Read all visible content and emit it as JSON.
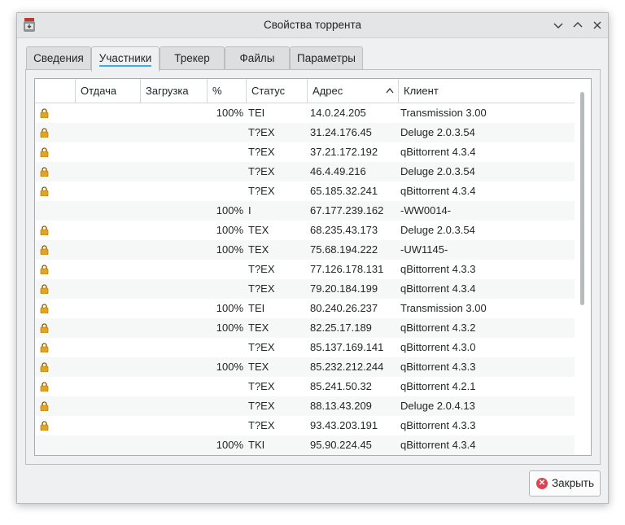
{
  "window": {
    "title": "Свойства торрента",
    "controls": {
      "minimize": "⌄",
      "maximize": "⌃",
      "close": "✕"
    }
  },
  "tabs": [
    {
      "label": "Сведения"
    },
    {
      "label": "Участники",
      "active": true
    },
    {
      "label": "Трекер"
    },
    {
      "label": "Файлы"
    },
    {
      "label": "Параметры"
    }
  ],
  "peers": {
    "columns": {
      "lock": "",
      "upload": "Отдача",
      "download": "Загрузка",
      "percent": "%",
      "status": "Статус",
      "address": "Адрес",
      "client": "Клиент"
    },
    "sort": {
      "column": "address",
      "direction": "ascending",
      "icon": "chevron-up-icon"
    },
    "rows": [
      {
        "lock": true,
        "percent": "100%",
        "status": "TEI",
        "address": "14.0.24.205",
        "client": "Transmission 3.00"
      },
      {
        "lock": true,
        "percent": "",
        "status": "T?EX",
        "address": "31.24.176.45",
        "client": "Deluge 2.0.3.54"
      },
      {
        "lock": true,
        "percent": "",
        "status": "T?EX",
        "address": "37.21.172.192",
        "client": "qBittorrent 4.3.4"
      },
      {
        "lock": true,
        "percent": "",
        "status": "T?EX",
        "address": "46.4.49.216",
        "client": "Deluge 2.0.3.54"
      },
      {
        "lock": true,
        "percent": "",
        "status": "T?EX",
        "address": "65.185.32.241",
        "client": "qBittorrent 4.3.4"
      },
      {
        "lock": false,
        "percent": "100%",
        "status": "I",
        "address": "67.177.239.162",
        "client": "-WW0014-"
      },
      {
        "lock": true,
        "percent": "100%",
        "status": "TEX",
        "address": "68.235.43.173",
        "client": "Deluge 2.0.3.54"
      },
      {
        "lock": true,
        "percent": "100%",
        "status": "TEX",
        "address": "75.68.194.222",
        "client": "-UW1145-"
      },
      {
        "lock": true,
        "percent": "",
        "status": "T?EX",
        "address": "77.126.178.131",
        "client": "qBittorrent 4.3.3"
      },
      {
        "lock": true,
        "percent": "",
        "status": "T?EX",
        "address": "79.20.184.199",
        "client": "qBittorrent 4.3.4"
      },
      {
        "lock": true,
        "percent": "100%",
        "status": "TEI",
        "address": "80.240.26.237",
        "client": "Transmission 3.00"
      },
      {
        "lock": true,
        "percent": "100%",
        "status": "TEX",
        "address": "82.25.17.189",
        "client": "qBittorrent 4.3.2"
      },
      {
        "lock": true,
        "percent": "",
        "status": "T?EX",
        "address": "85.137.169.141",
        "client": "qBittorrent 4.3.0"
      },
      {
        "lock": true,
        "percent": "100%",
        "status": "TEX",
        "address": "85.232.212.244",
        "client": "qBittorrent 4.3.3"
      },
      {
        "lock": true,
        "percent": "",
        "status": "T?EX",
        "address": "85.241.50.32",
        "client": "qBittorrent 4.2.1"
      },
      {
        "lock": true,
        "percent": "",
        "status": "T?EX",
        "address": "88.13.43.209",
        "client": "Deluge 2.0.4.13"
      },
      {
        "lock": true,
        "percent": "",
        "status": "T?EX",
        "address": "93.43.203.191",
        "client": "qBittorrent 4.3.3"
      },
      {
        "lock": false,
        "percent": "100%",
        "status": "TKI",
        "address": "95.90.224.45",
        "client": "qBittorrent 4.3.4"
      }
    ]
  },
  "buttons": {
    "close_label": "Закрыть"
  },
  "colors": {
    "accent": "#3daee9",
    "close_icon": "#da4453",
    "lock": "#e0a526"
  }
}
